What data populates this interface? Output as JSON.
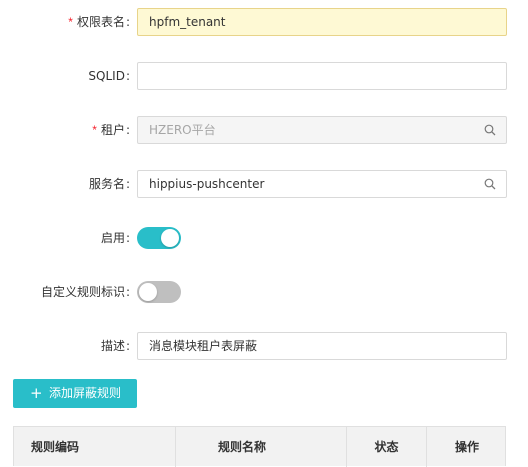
{
  "form": {
    "table_name": {
      "label": "权限表名",
      "value": "hpfm_tenant",
      "required": true
    },
    "sqlid": {
      "label": "SQLID",
      "value": ""
    },
    "tenant": {
      "label": "租户",
      "value": "HZERO平台",
      "required": true,
      "disabled": true
    },
    "service": {
      "label": "服务名",
      "value": "hippius-pushcenter"
    },
    "enabled": {
      "label": "启用",
      "on": true
    },
    "custom_rule": {
      "label": "自定义规则标识",
      "on": false
    },
    "description": {
      "label": "描述",
      "value": "消息模块租户表屏蔽"
    },
    "colon": ":",
    "required_mark": "*"
  },
  "actions": {
    "add_rule_label": "添加屏蔽规则",
    "add_icon": "+"
  },
  "table": {
    "columns": [
      "规则编码",
      "规则名称",
      "状态",
      "操作"
    ]
  },
  "colors": {
    "accent": "#29bec9",
    "required": "#f5222d",
    "highlight_bg": "#fef9d4"
  },
  "icons": {
    "search": "search-icon"
  }
}
